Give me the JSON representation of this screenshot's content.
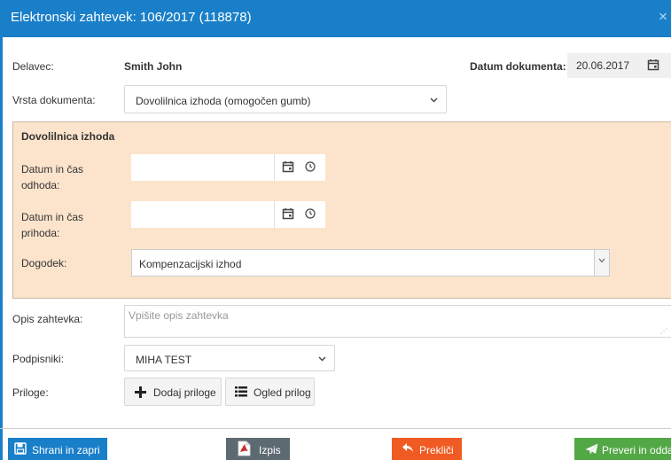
{
  "window": {
    "title": "Elektronski zahtevek: 106/2017 (118878)",
    "close_glyph": "×"
  },
  "employee": {
    "label": "Delavec:",
    "value": "Smith John"
  },
  "doc_date": {
    "label": "Datum dokumenta:",
    "value": "20.06.2017"
  },
  "doc_type": {
    "label": "Vrsta dokumenta:",
    "value": "Dovolilnica izhoda (omogočen gumb)"
  },
  "section": {
    "title": "Dovolilnica izhoda",
    "departure_label_1": "Datum in čas",
    "departure_label_2": "odhoda:",
    "arrival_label_1": "Datum in čas",
    "arrival_label_2": "prihoda:",
    "event_label": "Dogodek:",
    "event_value": "Kompenzacijski izhod"
  },
  "description": {
    "label": "Opis zahtevka:",
    "placeholder": "Vpišite opis zahtevka"
  },
  "signers": {
    "label": "Podpisniki:",
    "value": "MIHA TEST"
  },
  "attachments": {
    "label": "Priloge:",
    "add_label": "Dodaj priloge",
    "view_label": "Ogled prilog"
  },
  "footer": {
    "save_label": "Shrani in zapri",
    "print_label": "Izpis",
    "cancel_label": "Prekliči",
    "submit_label": "Preveri in oddaj"
  },
  "colors": {
    "header": "#1a7fc9",
    "section_bg": "#fce4cc",
    "save": "#1a7fc9",
    "print": "#5e6a72",
    "cancel": "#f05a23",
    "submit": "#52a845"
  },
  "icons": {
    "close": "close-icon",
    "calendar": "calendar-icon",
    "clock": "clock-icon",
    "chevron": "chevron-down-icon",
    "plus": "plus-icon",
    "list": "list-icon",
    "save": "floppy-disk-icon",
    "print": "pdf-icon",
    "cancel": "reply-arrow-icon",
    "submit": "paper-plane-icon"
  }
}
